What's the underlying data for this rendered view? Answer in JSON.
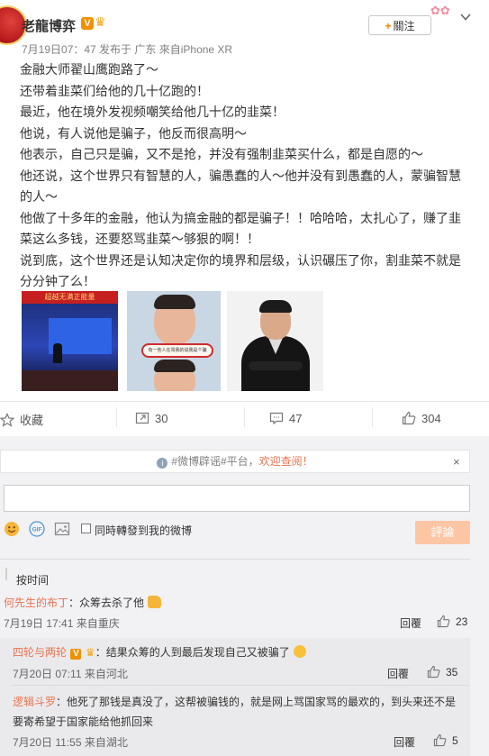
{
  "post": {
    "author": "老龍博弈",
    "verified_badge": "V",
    "meta": "7月19日07：47 发布于 广东 來自iPhone XR",
    "follow_label": "關注",
    "paragraphs": [
      "金融大师翟山鹰跑路了～",
      "还带着韭菜们给他的几十亿跑的！",
      "最近，他在境外发视频嘲笑给他几十亿的韭菜！",
      "他说，有人说他是骗子，他反而很高明～",
      "他表示，自己只是骗，又不是抢，并没有强制韭菜买什么，都是自愿的～",
      "他还说，这个世界只有智慧的人，骗愚蠢的人～他并没有到愚蠢的人，蒙骗智慧的人～",
      "他做了十多年的金融，他认为搞金融的都是骗子！！哈哈哈，太扎心了，赚了韭菜这么多钱，还要怒骂韭菜～够狠的啊！！",
      "说到底，这个世界还是认知决定你的境界和层级，认识碾压了你，割韭菜不就是分分钟了么！"
    ],
    "images": [
      {
        "name": "conference-photo",
        "banner": "超越无满正能量"
      },
      {
        "name": "video-screenshot",
        "caption": "有一些人在骂我的说我是个骗"
      },
      {
        "name": "portrait-photo"
      }
    ]
  },
  "actions": {
    "favorite_label": "收藏",
    "repost_count": "30",
    "comment_count": "47",
    "like_count": "304"
  },
  "comment_area": {
    "notice_prefix": "#微博辟谣#平台，",
    "notice_link": "欢迎查阅！",
    "notice_close": "×",
    "checkbox_label": "同時轉發到我的微博",
    "submit_label": "評論",
    "sort_label": "按时间"
  },
  "comments": [
    {
      "user": "何先生的布丁",
      "text": "：众筹去杀了他",
      "time": "7月19日 17:41 来自重庆",
      "reply_label": "回覆",
      "likes": "23"
    }
  ],
  "replies": [
    {
      "user": "四轮与两轮",
      "badge": "V",
      "text": "：结果众筹的人到最后发现自己又被骗了",
      "time": "7月20日 07:11 来自河北",
      "reply_label": "回覆",
      "likes": "35"
    },
    {
      "user": "逻辑斗罗",
      "text": "：他死了那钱是真没了，这帮被骗钱的，就是网上骂国家骂的最欢的，到头来还不是要寄希望于国家能给他抓回来",
      "time": "7月20日 11:55 来自湖北",
      "reply_label": "回覆",
      "likes": "5"
    }
  ],
  "colors": {
    "accent_orange": "#ff8200",
    "link_orange": "#eb7350",
    "submit_disabled": "#fcc6a5"
  }
}
